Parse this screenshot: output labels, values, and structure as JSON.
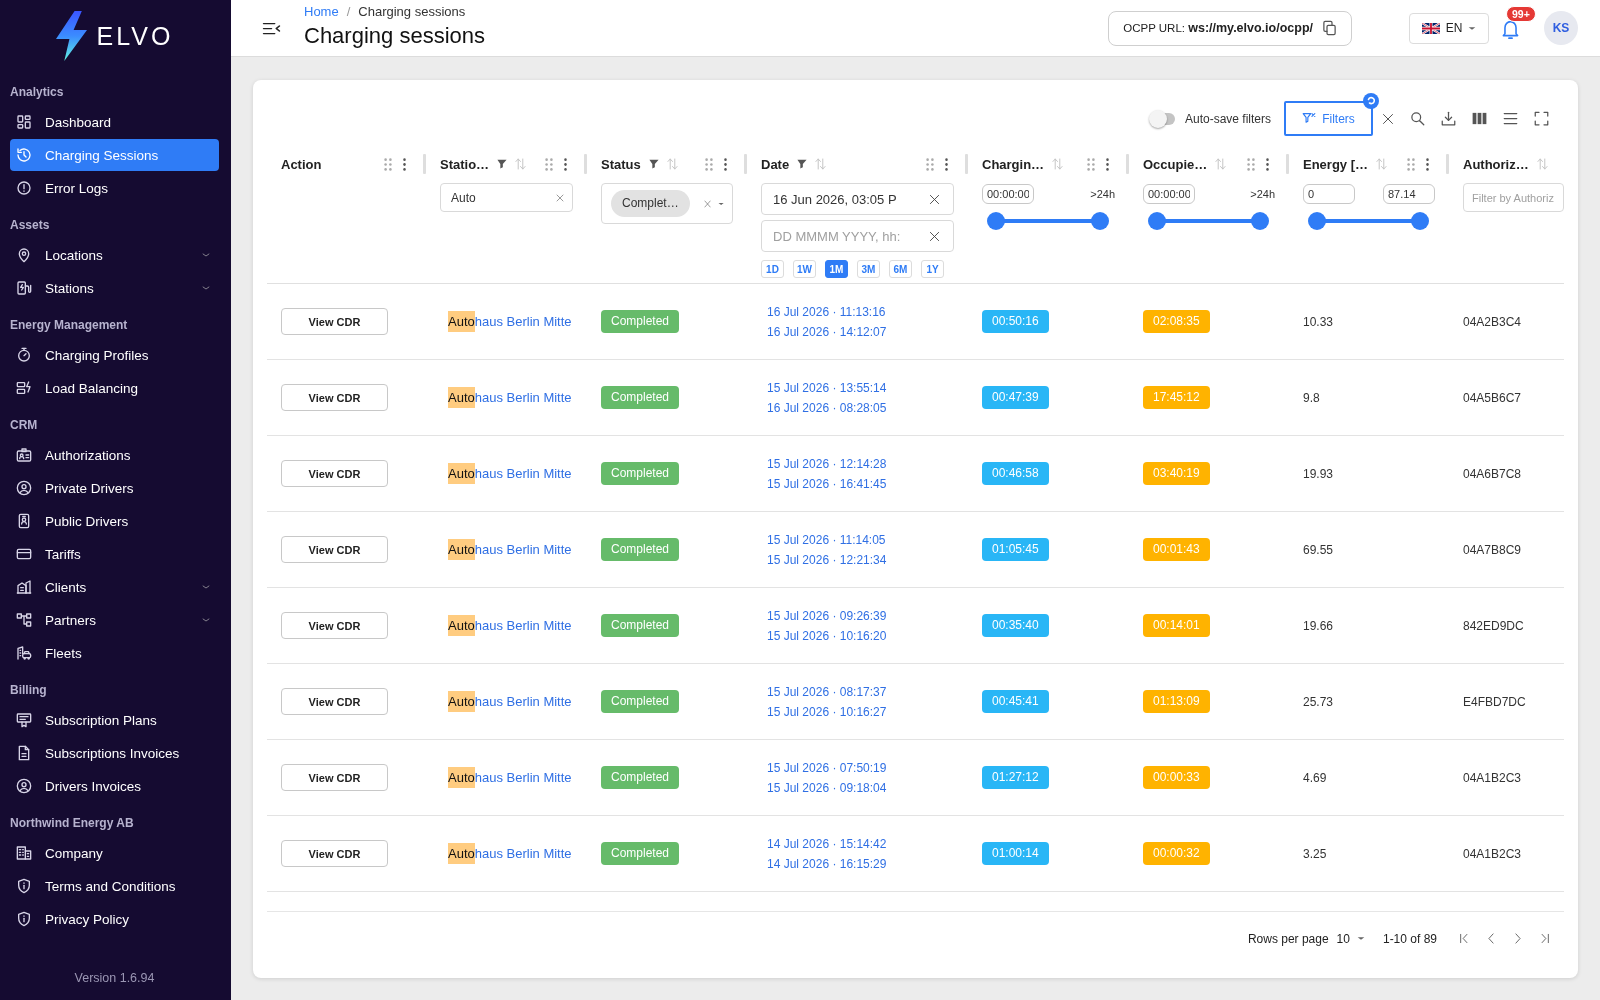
{
  "sidebar": {
    "brand": "ELVO",
    "sections": [
      {
        "title": "Analytics",
        "items": [
          {
            "label": "Dashboard",
            "kind": "link",
            "selected": false
          },
          {
            "label": "Charging Sessions",
            "kind": "link",
            "selected": true
          },
          {
            "label": "Error Logs",
            "kind": "link",
            "selected": false
          }
        ]
      },
      {
        "title": "Assets",
        "items": [
          {
            "label": "Locations",
            "kind": "group",
            "selected": false
          },
          {
            "label": "Stations",
            "kind": "group",
            "selected": false
          }
        ]
      },
      {
        "title": "Energy Management",
        "items": [
          {
            "label": "Charging Profiles",
            "kind": "link",
            "selected": false
          },
          {
            "label": "Load Balancing",
            "kind": "link",
            "selected": false
          }
        ]
      },
      {
        "title": "CRM",
        "items": [
          {
            "label": "Authorizations",
            "kind": "link",
            "selected": false
          },
          {
            "label": "Private Drivers",
            "kind": "link",
            "selected": false
          },
          {
            "label": "Public Drivers",
            "kind": "link",
            "selected": false
          },
          {
            "label": "Tariffs",
            "kind": "link",
            "selected": false
          },
          {
            "label": "Clients",
            "kind": "group",
            "selected": false
          },
          {
            "label": "Partners",
            "kind": "group",
            "selected": false
          },
          {
            "label": "Fleets",
            "kind": "link",
            "selected": false
          }
        ]
      },
      {
        "title": "Billing",
        "items": [
          {
            "label": "Subscription Plans",
            "kind": "link",
            "selected": false
          },
          {
            "label": "Subscriptions Invoices",
            "kind": "link",
            "selected": false
          },
          {
            "label": "Drivers Invoices",
            "kind": "link",
            "selected": false
          }
        ]
      },
      {
        "title": "Northwind Energy AB",
        "items": [
          {
            "label": "Company",
            "kind": "link",
            "selected": false
          },
          {
            "label": "Terms and Conditions",
            "kind": "link",
            "selected": false
          },
          {
            "label": "Privacy Policy",
            "kind": "link",
            "selected": false
          }
        ]
      }
    ],
    "version": "Version 1.6.94"
  },
  "header": {
    "breadcrumb": {
      "items": [
        "Home",
        "Charging sessions"
      ],
      "separator": "/"
    },
    "title": "Charging sessions",
    "ocpp_url": "OCPP URL: **ws://my.elvo.io/ocpp/**",
    "language": "EN",
    "notification_count": "99+",
    "user_initials": "KS"
  },
  "toolbar": {
    "auto_save": {
      "label": "Auto-save filters",
      "on": false
    },
    "filters_button": "Filters"
  },
  "table": {
    "columns": [
      {
        "title": "Action",
        "filtered": false,
        "sortable": false
      },
      {
        "title": "Statio…",
        "filtered": true,
        "sortable": true,
        "filter": {
          "kind": "text",
          "value": "Auto"
        }
      },
      {
        "title": "Status",
        "filtered": true,
        "sortable": true,
        "filter": {
          "kind": "select",
          "chips": [
            "Complet…"
          ]
        }
      },
      {
        "title": "Date",
        "filtered": true,
        "sortable": true,
        "filter": {
          "kind": "date",
          "value": "16 Jun 2026, 03:05 P",
          "placeholder": "DD MMMM YYYY, hh:",
          "presets": [
            {
              "label": "1D",
              "selected": false
            },
            {
              "label": "1W",
              "selected": false
            },
            {
              "label": "1M",
              "selected": true
            },
            {
              "label": "3M",
              "selected": false
            },
            {
              "label": "6M",
              "selected": false
            },
            {
              "label": "1Y",
              "selected": false
            }
          ]
        }
      },
      {
        "title": "Chargin…",
        "filtered": false,
        "sortable": true,
        "filter": {
          "kind": "range",
          "min": {
            "kind": "input",
            "text": "00:00:00"
          },
          "max": {
            "kind": "label",
            "text": ">24h"
          },
          "level": 1
        }
      },
      {
        "title": "Occupie…",
        "filtered": false,
        "sortable": true,
        "filter": {
          "kind": "range",
          "min": {
            "kind": "input",
            "text": "00:00:00"
          },
          "max": {
            "kind": "label",
            "text": ">24h"
          },
          "level": 1
        }
      },
      {
        "title": "Energy […",
        "filtered": false,
        "sortable": true,
        "filter": {
          "kind": "range",
          "min": {
            "kind": "input",
            "text": "0"
          },
          "max": {
            "kind": "input",
            "text": "87.14"
          },
          "level": 1
        }
      },
      {
        "title": "Authoriz…",
        "filtered": false,
        "sortable": true,
        "filter": {
          "kind": "text",
          "placeholder": "Filter by Authoriz"
        }
      }
    ],
    "rows": [
      {
        "action": "View CDR",
        "station": {
          "match": "Auto",
          "rest": "haus Berlin Mitte"
        },
        "status": "Completed",
        "start": "16 Jul 2026 · 11:13:16",
        "end": "16 Jul 2026 · 14:12:07",
        "charging": "00:50:16",
        "occupied": "02:08:35",
        "energy": "10.33",
        "authorization": "04A2B3C4"
      },
      {
        "action": "View CDR",
        "station": {
          "match": "Auto",
          "rest": "haus Berlin Mitte"
        },
        "status": "Completed",
        "start": "15 Jul 2026 · 13:55:14",
        "end": "16 Jul 2026 · 08:28:05",
        "charging": "00:47:39",
        "occupied": "17:45:12",
        "energy": "9.8",
        "authorization": "04A5B6C7"
      },
      {
        "action": "View CDR",
        "station": {
          "match": "Auto",
          "rest": "haus Berlin Mitte"
        },
        "status": "Completed",
        "start": "15 Jul 2026 · 12:14:28",
        "end": "15 Jul 2026 · 16:41:45",
        "charging": "00:46:58",
        "occupied": "03:40:19",
        "energy": "19.93",
        "authorization": "04A6B7C8"
      },
      {
        "action": "View CDR",
        "station": {
          "match": "Auto",
          "rest": "haus Berlin Mitte"
        },
        "status": "Completed",
        "start": "15 Jul 2026 · 11:14:05",
        "end": "15 Jul 2026 · 12:21:34",
        "charging": "01:05:45",
        "occupied": "00:01:43",
        "energy": "69.55",
        "authorization": "04A7B8C9"
      },
      {
        "action": "View CDR",
        "station": {
          "match": "Auto",
          "rest": "haus Berlin Mitte"
        },
        "status": "Completed",
        "start": "15 Jul 2026 · 09:26:39",
        "end": "15 Jul 2026 · 10:16:20",
        "charging": "00:35:40",
        "occupied": "00:14:01",
        "energy": "19.66",
        "authorization": "842ED9DC"
      },
      {
        "action": "View CDR",
        "station": {
          "match": "Auto",
          "rest": "haus Berlin Mitte"
        },
        "status": "Completed",
        "start": "15 Jul 2026 · 08:17:37",
        "end": "15 Jul 2026 · 10:16:27",
        "charging": "00:45:41",
        "occupied": "01:13:09",
        "energy": "25.73",
        "authorization": "E4FBD7DC"
      },
      {
        "action": "View CDR",
        "station": {
          "match": "Auto",
          "rest": "haus Berlin Mitte"
        },
        "status": "Completed",
        "start": "15 Jul 2026 · 07:50:19",
        "end": "15 Jul 2026 · 09:18:04",
        "charging": "01:27:12",
        "occupied": "00:00:33",
        "energy": "4.69",
        "authorization": "04A1B2C3"
      },
      {
        "action": "View CDR",
        "station": {
          "match": "Auto",
          "rest": "haus Berlin Mitte"
        },
        "status": "Completed",
        "start": "14 Jul 2026 · 15:14:42",
        "end": "14 Jul 2026 · 16:15:29",
        "charging": "01:00:14",
        "occupied": "00:00:32",
        "energy": "3.25",
        "authorization": "04A1B2C3"
      }
    ]
  },
  "pagination": {
    "rows_per_page_label": "Rows per page",
    "rows_per_page": "10",
    "range": "1-10 of 89"
  }
}
